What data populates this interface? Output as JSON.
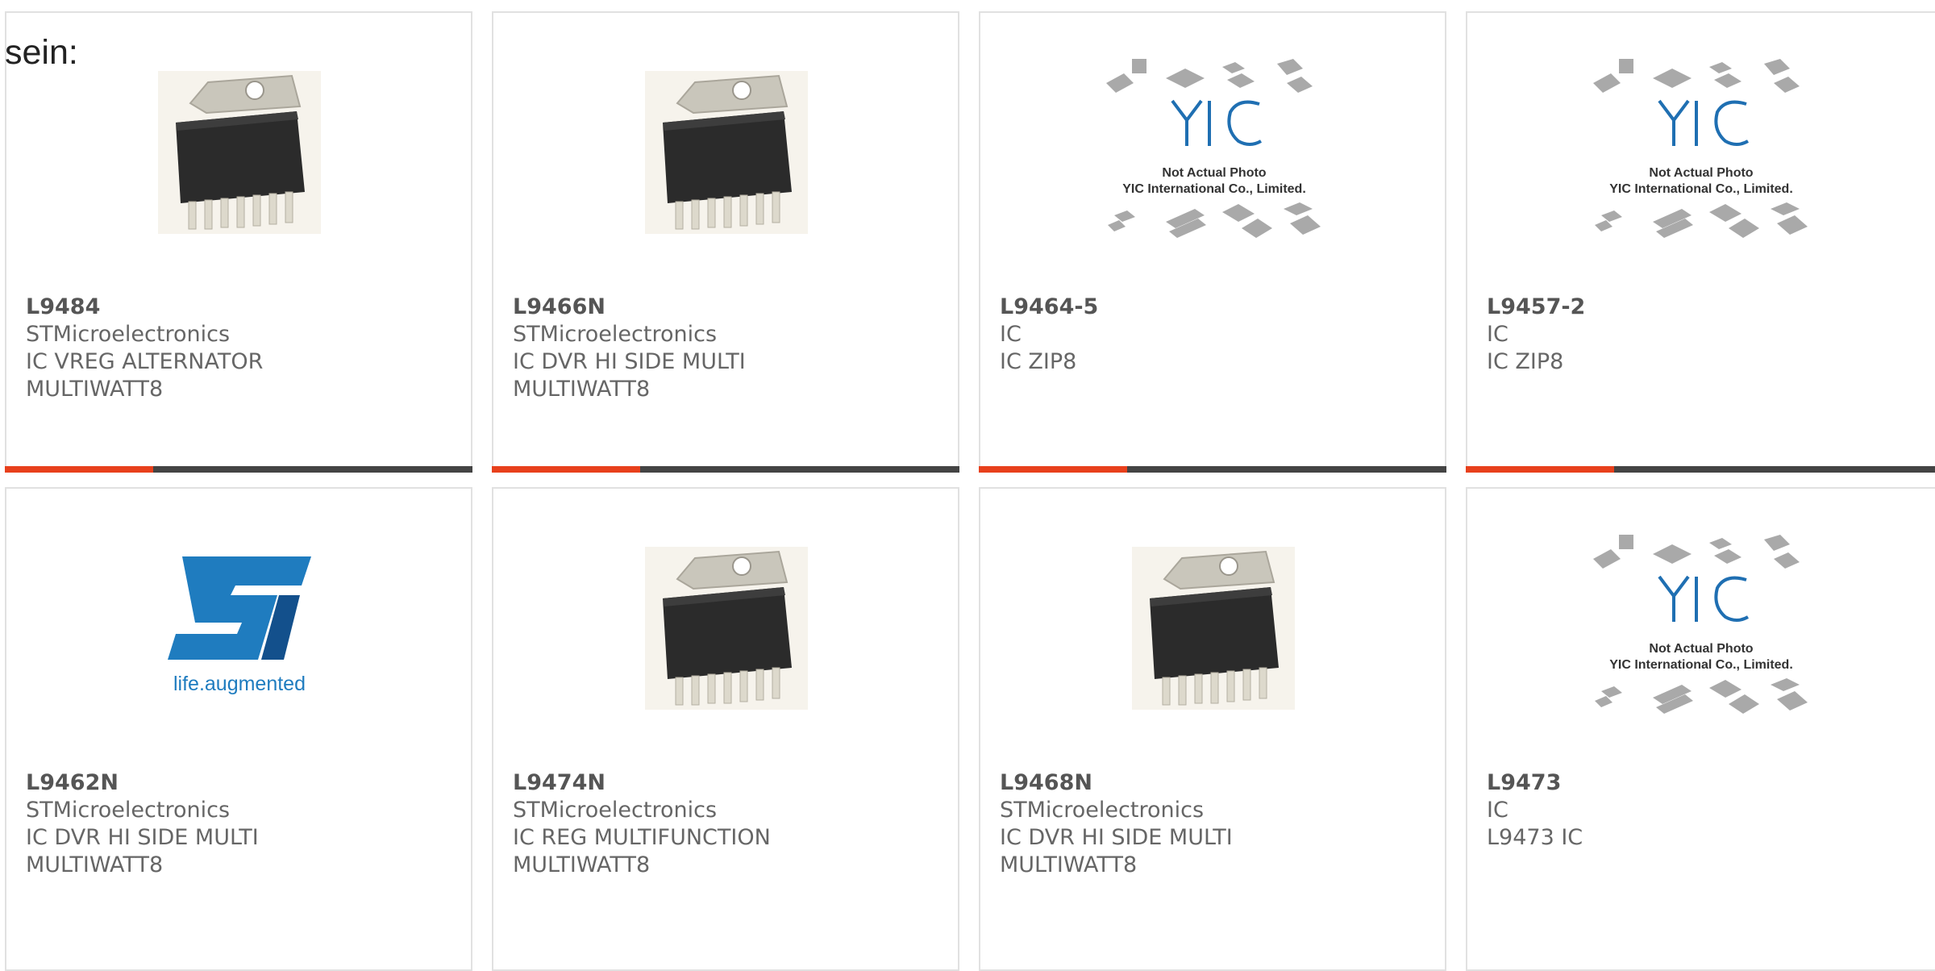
{
  "lead_text": "sein:",
  "colors": {
    "accent": "#e8401c",
    "bar": "#444444",
    "border": "#e1e1e1",
    "text": "#555555"
  },
  "products": [
    {
      "part": "L9484",
      "maker": "STMicroelectronics",
      "desc1": "IC VREG ALTERNATOR",
      "desc2": "MULTIWATT8",
      "image": "multiwatt-package-photo"
    },
    {
      "part": "L9466N",
      "maker": "STMicroelectronics",
      "desc1": "IC DVR HI SIDE MULTI",
      "desc2": "MULTIWATT8",
      "image": "multiwatt-package-photo"
    },
    {
      "part": "L9464-5",
      "maker": "IC",
      "desc1": "IC ZIP8",
      "desc2": "",
      "image": "yic-placeholder",
      "placeholder_lines": [
        "Not Actual Photo",
        "YIC International Co., Limited."
      ]
    },
    {
      "part": "L9457-2",
      "maker": "IC",
      "desc1": "IC ZIP8",
      "desc2": "",
      "image": "yic-placeholder",
      "placeholder_lines": [
        "Not Actual Photo",
        "YIC International Co., Limited."
      ]
    },
    {
      "part": "L9462N",
      "maker": "STMicroelectronics",
      "desc1": "IC DVR HI SIDE MULTI",
      "desc2": "MULTIWATT8",
      "image": "st-logo",
      "logo_tagline": "life.augmented"
    },
    {
      "part": "L9474N",
      "maker": "STMicroelectronics",
      "desc1": "IC REG MULTIFUNCTION",
      "desc2": "MULTIWATT8",
      "image": "multiwatt-package-photo"
    },
    {
      "part": "L9468N",
      "maker": "STMicroelectronics",
      "desc1": "IC DVR HI SIDE MULTI",
      "desc2": "MULTIWATT8",
      "image": "multiwatt-package-photo"
    },
    {
      "part": "L9473",
      "maker": "IC",
      "desc1": "L9473 IC",
      "desc2": "",
      "image": "yic-placeholder",
      "placeholder_lines": [
        "Not Actual Photo",
        "YIC International Co., Limited."
      ]
    }
  ]
}
